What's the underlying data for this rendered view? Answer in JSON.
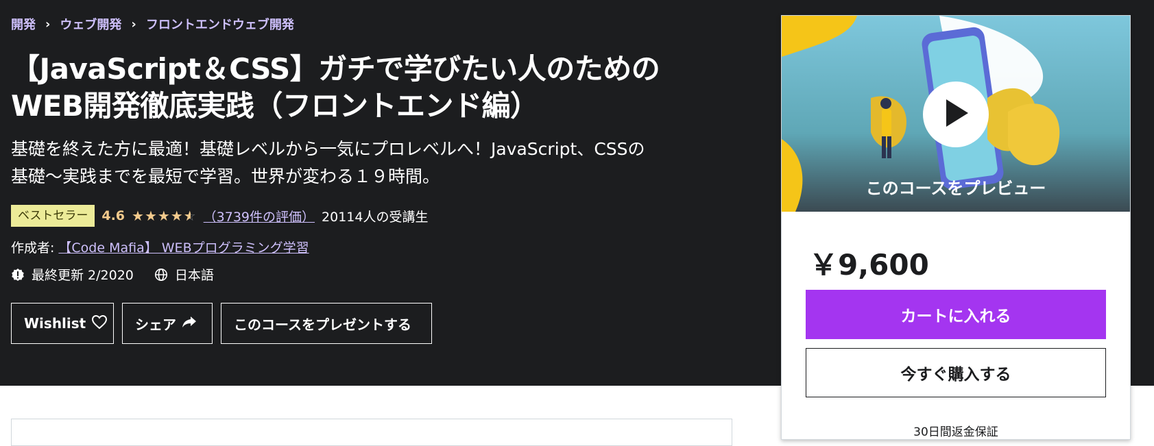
{
  "breadcrumb": {
    "items": [
      "開発",
      "ウェブ開発",
      "フロントエンドウェブ開発"
    ],
    "separator": "›"
  },
  "course": {
    "title_line1": "【JavaScript＆CSS】ガチで学びたい人のための",
    "title_line2": "WEB開発徹底実践（フロントエンド編）",
    "subtitle_line1": "基礎を終えた方に最適！基礎レベルから一気にプロレベルへ！JavaScript、CSSの",
    "subtitle_line2": "基礎〜実践までを最短で学習。世界が変わる１９時間。",
    "badge": "ベストセラー",
    "rating": "4.6",
    "rating_value": 4.6,
    "ratings_count": "（3739件の評価）",
    "students": "20114人の受講生",
    "author_prefix": "作成者:",
    "author": "【Code Mafia】 WEBプログラミング学習",
    "last_updated": "最終更新 2/2020",
    "language": "日本語"
  },
  "actions": {
    "wishlist": "Wishlist",
    "share": "シェア",
    "gift": "このコースをプレゼントする"
  },
  "sidebar": {
    "preview_label": "このコースをプレビュー",
    "price": "￥9,600",
    "add_to_cart": "カートに入れる",
    "buy_now": "今すぐ購入する",
    "guarantee": "30日間返金保証"
  },
  "colors": {
    "hero_bg": "#1c1d1f",
    "accent_purple": "#a435f0",
    "link_purple": "#cec0fc",
    "star_gold": "#f3ca8c",
    "badge_bg": "#eceb98"
  }
}
